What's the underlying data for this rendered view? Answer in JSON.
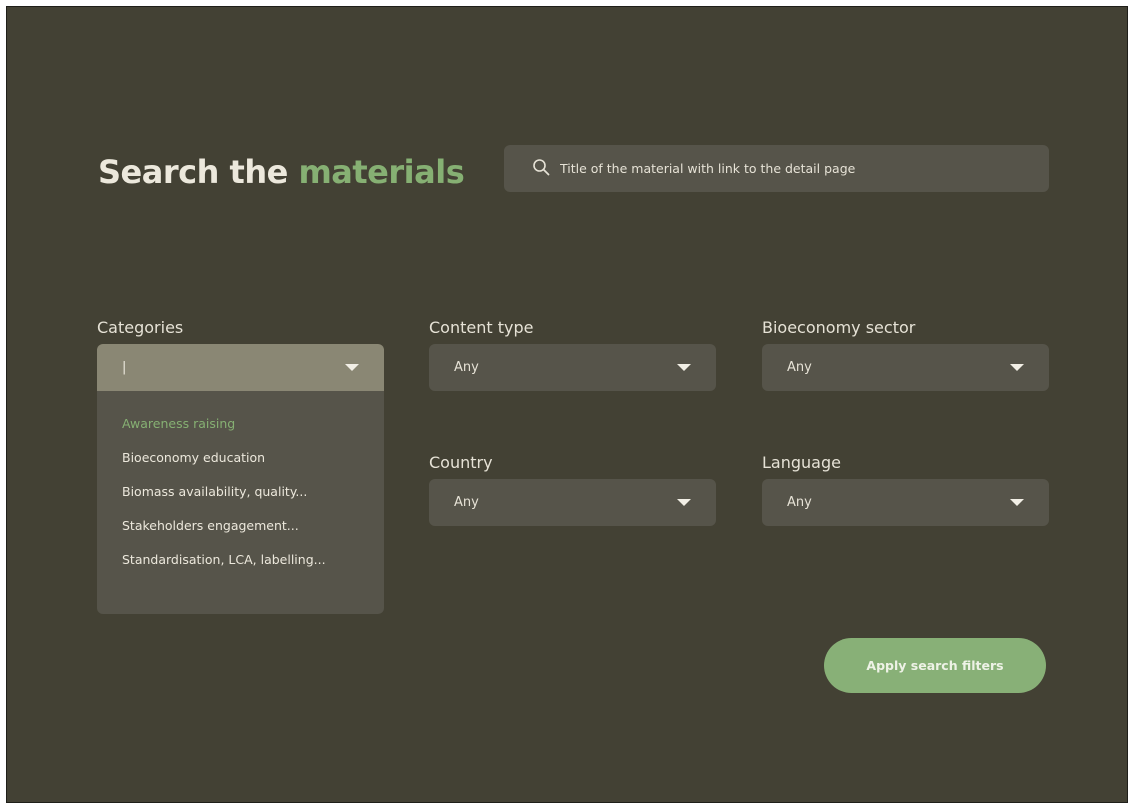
{
  "header": {
    "title_main": "Search the ",
    "title_accent": "materials"
  },
  "search": {
    "placeholder": "Title of the material with link to the detail page",
    "icon": "search-icon"
  },
  "filters": {
    "categories": {
      "label": "Categories",
      "value": "|",
      "options": [
        "Awareness raising",
        "Bioeconomy education",
        "Biomass availability, quality...",
        "Stakeholders engagement...",
        "Standardisation, LCA, labelling..."
      ],
      "highlighted_option": "Awareness raising"
    },
    "content_type": {
      "label": "Content type",
      "value": "Any"
    },
    "bioeconomy_sector": {
      "label": "Bioeconomy sector",
      "value": "Any"
    },
    "country": {
      "label": "Country",
      "value": "Any"
    },
    "language": {
      "label": "Language",
      "value": "Any"
    }
  },
  "actions": {
    "apply_label": "Apply search filters"
  },
  "colors": {
    "background": "#434134",
    "accent": "#86b073",
    "field": "#56544a",
    "active_field": "#8a8774",
    "button": "#88b077"
  }
}
